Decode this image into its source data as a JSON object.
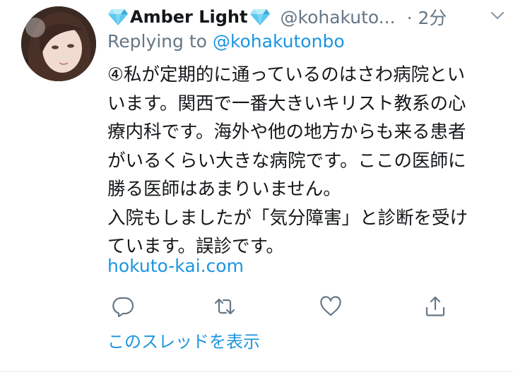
{
  "tweet": {
    "display_name": "Amber Light",
    "handle": "@kohakuto...",
    "time": "· 2分",
    "reply_prefix": "Replying to",
    "reply_mention": "@kohakutonbo",
    "body_lines": [
      "④私が定期的に通っているのはさわ病院とい",
      "います。関西で一番大きいキリスト教系の心",
      "療内科です。海外や他の地方からも来る患者",
      "がいるくらい大きな病院です。ここの医師に",
      "勝る医師はあまりいません。",
      "入院もしましたが「気分障害」と診断を受け",
      "ています。誤診です。"
    ],
    "link": "hokuto-kai.com",
    "thread_link": "このスレッドを表示"
  },
  "icons": {
    "name_decoration": "diamond-icon",
    "reply": "reply-icon",
    "retweet": "retweet-icon",
    "like": "heart-icon",
    "share": "share-icon",
    "more": "chevron-down-icon"
  },
  "colors": {
    "text": "#14171a",
    "secondary": "#657786",
    "link": "#1b95e0",
    "diamond": "#5ec8ef"
  }
}
